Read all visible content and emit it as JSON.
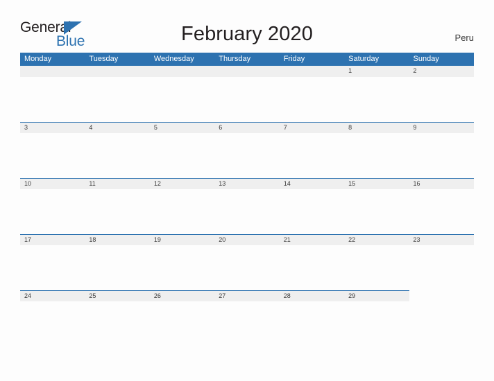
{
  "brand": {
    "name_top": "General",
    "name_bottom": "Blue",
    "accent_color": "#2d72b0"
  },
  "header": {
    "title": "February 2020",
    "region": "Peru"
  },
  "calendar": {
    "weekday_headers": [
      "Monday",
      "Tuesday",
      "Wednesday",
      "Thursday",
      "Friday",
      "Saturday",
      "Sunday"
    ],
    "header_bg": "#2d72b0",
    "band_bg": "#efefef",
    "weeks": [
      {
        "days": [
          "",
          "",
          "",
          "",
          "",
          "1",
          "2"
        ],
        "filled": [
          true,
          true,
          true,
          true,
          true,
          true,
          true
        ]
      },
      {
        "days": [
          "3",
          "4",
          "5",
          "6",
          "7",
          "8",
          "9"
        ],
        "filled": [
          true,
          true,
          true,
          true,
          true,
          true,
          true
        ]
      },
      {
        "days": [
          "10",
          "11",
          "12",
          "13",
          "14",
          "15",
          "16"
        ],
        "filled": [
          true,
          true,
          true,
          true,
          true,
          true,
          true
        ]
      },
      {
        "days": [
          "17",
          "18",
          "19",
          "20",
          "21",
          "22",
          "23"
        ],
        "filled": [
          true,
          true,
          true,
          true,
          true,
          true,
          true
        ]
      },
      {
        "days": [
          "24",
          "25",
          "26",
          "27",
          "28",
          "29",
          ""
        ],
        "filled": [
          true,
          true,
          true,
          true,
          true,
          true,
          false
        ]
      }
    ]
  }
}
